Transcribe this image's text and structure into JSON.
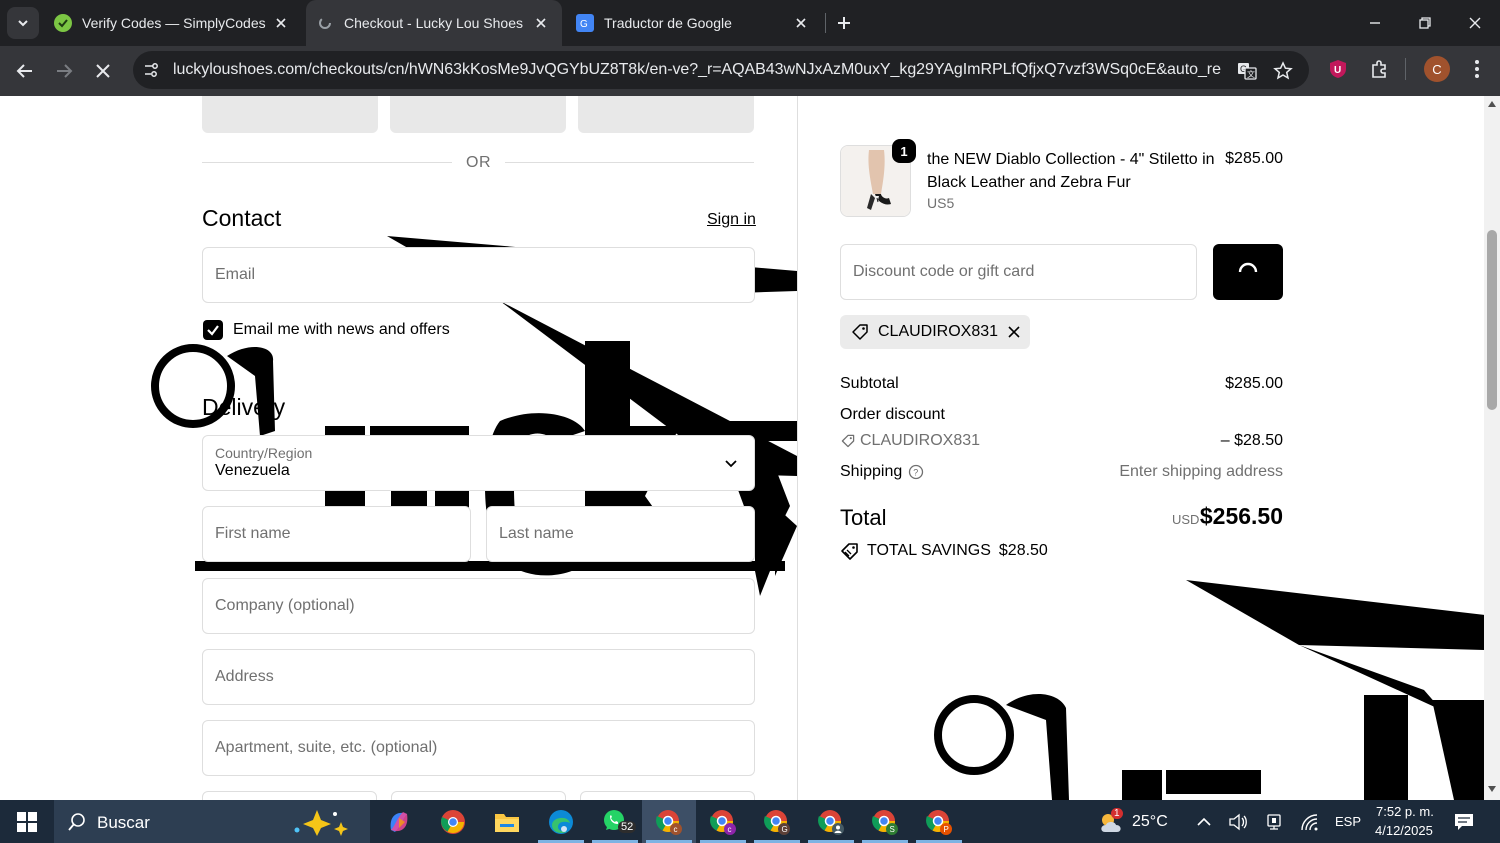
{
  "browser": {
    "tabs": [
      {
        "title": "Verify Codes — SimplyCodes",
        "active": false
      },
      {
        "title": "Checkout - Lucky Lou Shoes",
        "active": true
      },
      {
        "title": "Traductor de Google",
        "active": false
      }
    ],
    "url": "luckyloushoes.com/checkouts/cn/hWN63kKosMe9JvQGYbUZ8T8k/en-ve?_r=AQAB43wNJxAzM0uxY_kg29YAgImRPLfQfjxQ7vzf3WSq0cE&auto_redirect=f...",
    "profile_initial": "C",
    "extension_badge": "U"
  },
  "checkout": {
    "or_label": "OR",
    "contact": {
      "heading": "Contact",
      "sign_in": "Sign in",
      "email_placeholder": "Email",
      "newsletter_label": "Email me with news and offers",
      "newsletter_checked": true
    },
    "delivery": {
      "heading": "Delivery",
      "country_label": "Country/Region",
      "country_value": "Venezuela",
      "first_name_placeholder": "First name",
      "last_name_placeholder": "Last name",
      "company_placeholder": "Company (optional)",
      "address_placeholder": "Address",
      "apartment_placeholder": "Apartment, suite, etc. (optional)"
    }
  },
  "order_summary": {
    "item": {
      "quantity": "1",
      "title": "the NEW Diablo Collection - 4\" Stiletto in Black Leather and Zebra Fur",
      "variant": "US5",
      "price": "$285.00"
    },
    "discount_placeholder": "Discount code or gift card",
    "applied_code": "CLAUDIROX831",
    "subtotal_label": "Subtotal",
    "subtotal_value": "$285.00",
    "order_discount_label": "Order discount",
    "discount_code": "CLAUDIROX831",
    "discount_value": "– $28.50",
    "shipping_label": "Shipping",
    "shipping_value": "Enter shipping address",
    "total_label": "Total",
    "currency": "USD",
    "total_value": "$256.50",
    "savings_label": "TOTAL SAVINGS",
    "savings_value": "$28.50"
  },
  "taskbar": {
    "search_label": "Buscar",
    "whatsapp_badge": "52",
    "weather_temp": "25°C",
    "weather_badge": "1",
    "language": "ESP",
    "time": "7:52 p. m.",
    "date": "4/12/2025"
  },
  "colors": {
    "chrome_dark": "#202124",
    "chrome_toolbar": "#35363a",
    "taskbar": "#1c2a3a",
    "page_black": "#000000"
  }
}
